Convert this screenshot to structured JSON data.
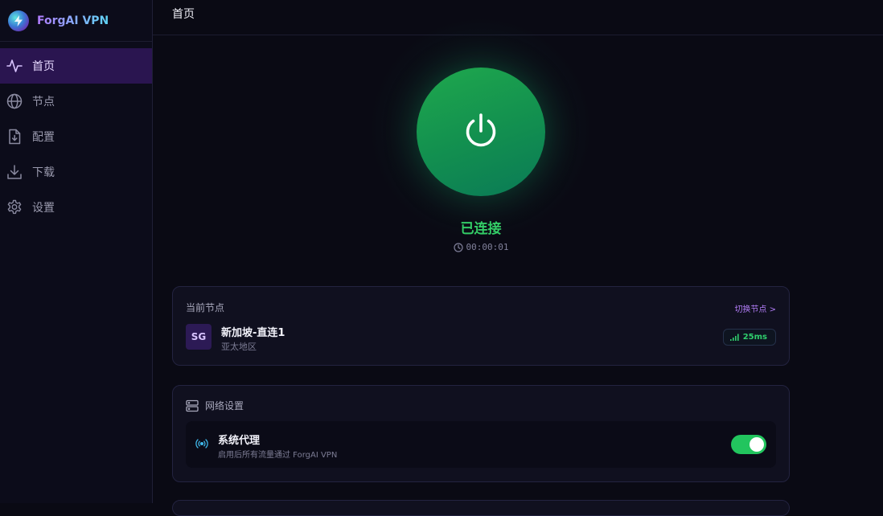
{
  "app": {
    "name": "ForgAI VPN",
    "logo_icon": "lightning-bolt-icon"
  },
  "sidebar": {
    "items": [
      {
        "label": "首页",
        "icon": "activity-pulse-icon",
        "active": true
      },
      {
        "label": "节点",
        "icon": "globe-icon",
        "active": false
      },
      {
        "label": "配置",
        "icon": "file-download-icon",
        "active": false
      },
      {
        "label": "下载",
        "icon": "download-icon",
        "active": false
      },
      {
        "label": "设置",
        "icon": "gear-icon",
        "active": false
      }
    ]
  },
  "header": {
    "title": "首页"
  },
  "connection": {
    "status": "已连接",
    "elapsed": "00:00:01",
    "power_icon": "power-icon",
    "status_color": "#33cc66",
    "button_color": "#16a34a"
  },
  "node_card": {
    "label": "当前节点",
    "switch_label": "切换节点 >",
    "badge": "SG",
    "name": "新加坡-直连1",
    "region": "亚太地区",
    "latency": "25ms",
    "latency_icon": "signal-bars-icon"
  },
  "network_card": {
    "label": "网络设置",
    "header_icon": "server-icon",
    "proxy": {
      "title": "系统代理",
      "description": "启用后所有流量通过 ForgAI VPN",
      "icon": "broadcast-icon",
      "enabled": true
    }
  },
  "colors": {
    "accent": "#b07cf5",
    "active_nav_bg": "#2a1550",
    "toggle_on": "#22c55e",
    "latency_green": "#2fcf6d"
  }
}
